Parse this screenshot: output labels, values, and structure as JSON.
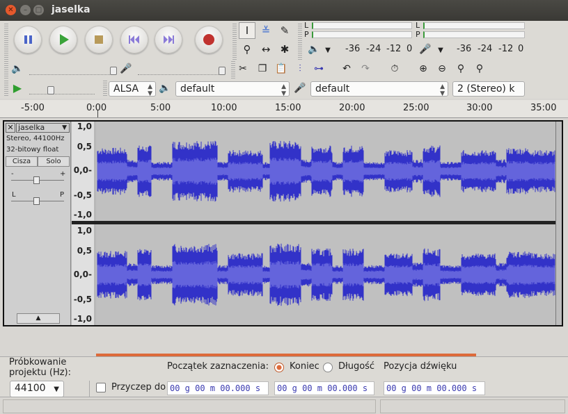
{
  "window": {
    "title": "jaselka"
  },
  "transport": {
    "pause": "pause-icon",
    "play": "play-icon",
    "stop": "stop-icon",
    "skip_start": "skip-start-icon",
    "skip_end": "skip-end-icon",
    "record": "record-icon"
  },
  "meters": {
    "rec_L": "L",
    "rec_R": "P",
    "play_L": "L",
    "play_R": "P",
    "rec_ticks": [
      "-36",
      "-24",
      "-12",
      "0"
    ],
    "play_ticks": [
      "-36",
      "-24",
      "-12",
      "0"
    ]
  },
  "device": {
    "host": "ALSA",
    "output": "default",
    "input": "default",
    "channels": "2 (Stereo) k"
  },
  "ruler": {
    "labels": [
      "-5:00",
      "0:00",
      "5:00",
      "10:00",
      "15:00",
      "20:00",
      "25:00",
      "30:00",
      "35:00"
    ]
  },
  "track": {
    "name": "jaselka",
    "info1": "Stereo, 44100Hz",
    "info2": "32-bitowy float",
    "mute": "Cisza",
    "solo": "Solo",
    "gain_minus": "-",
    "gain_plus": "+",
    "pan_left": "L",
    "pan_right": "P",
    "scale": [
      "1,0",
      "0,5",
      "0,0-",
      "-0,5",
      "-1,0"
    ]
  },
  "selection_bar": {
    "rate_label": "Próbkowanie projektu (Hz):",
    "rate_value": "44100",
    "snap_label": "Przyczep do",
    "sel_start_label": "Początek zaznaczenia:",
    "end_label": "Koniec",
    "length_label": "Długość",
    "pos_label": "Pozycja dźwięku",
    "time1": "00 g 00 m 00.000 s",
    "time2": "00 g 00 m 00.000 s",
    "time3": "00 g 00 m 00.000 s"
  },
  "colors": {
    "wave": "#3232c8",
    "wave_rms": "#6464dc",
    "record": "#c0322f",
    "play": "#2f9e2f",
    "selection_start": "#dd6a3a"
  }
}
